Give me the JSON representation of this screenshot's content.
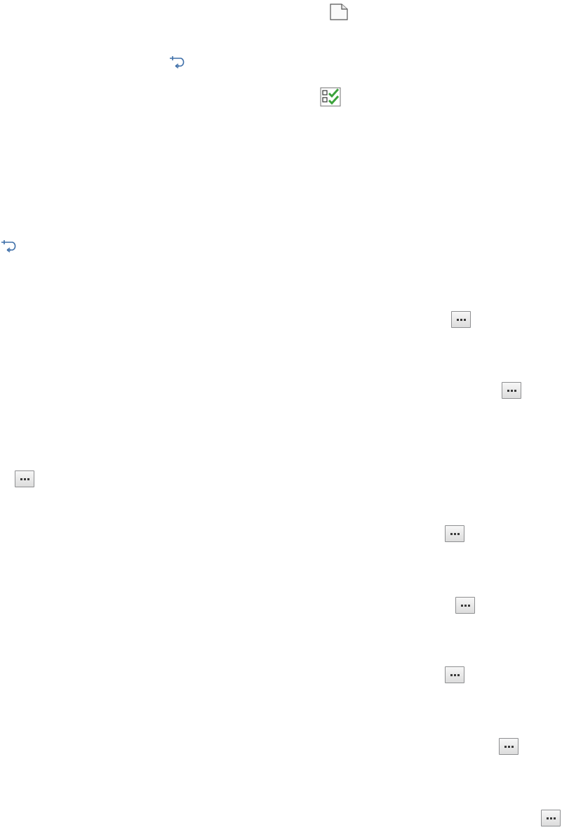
{
  "icons": {
    "document": "document-icon",
    "loop_return": "loop-return-icon",
    "checklist": "checklist-icon",
    "ellipsis": "ellipsis-icon"
  },
  "buttons": {
    "ellipsis_label": "…",
    "count": 8
  },
  "colors": {
    "loop_arrow": "#3d6ea8",
    "check_green": "#3aa23a",
    "button_border": "#8e8f91",
    "doc_outline": "#555555"
  }
}
